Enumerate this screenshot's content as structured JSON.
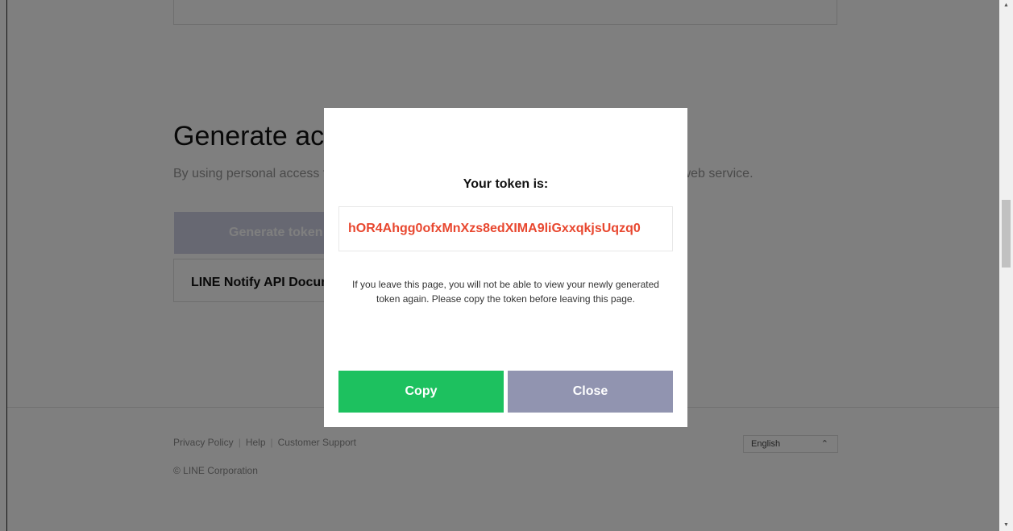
{
  "page": {
    "section_title": "Generate access token (For developers)",
    "section_desc": "By using personal access tokens, you can configure notifications without having to add a web service.",
    "generate_button": "Generate token",
    "doc_link": "LINE Notify API Document"
  },
  "footer": {
    "links": [
      "Privacy Policy",
      "Help",
      "Customer Support"
    ],
    "copyright": "© LINE Corporation",
    "language": "English"
  },
  "modal": {
    "title": "Your token is:",
    "token": "hOR4Ahgg0ofxMnXzs8edXIMA9liGxxqkjsUqzq0",
    "message": "If you leave this page, you will not be able to view your newly generated token again. Please copy the token before leaving this page.",
    "copy_label": "Copy",
    "close_label": "Close"
  },
  "colors": {
    "copy_button": "#1dc15f",
    "close_button": "#9194b0",
    "token_text": "#e8472f"
  },
  "icons": {
    "language_chevron": "chevron-up-icon",
    "scroll_up": "scroll-up-arrow-icon",
    "scroll_down": "scroll-down-arrow-icon"
  }
}
